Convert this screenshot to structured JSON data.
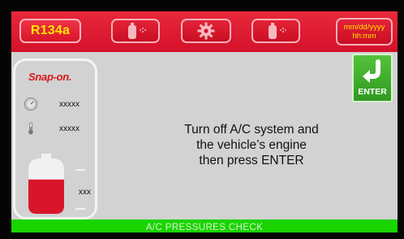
{
  "header": {
    "refrigerant": "R134a",
    "datetime_line1": "mm/dd/yyyy",
    "datetime_line2": "hh:mm",
    "icons": [
      "bottle-icon",
      "gear-icon",
      "bottle-icon"
    ]
  },
  "gauges": {
    "brand": "Snap-on.",
    "pressure_value": "xxxxx",
    "temperature_value": "xxxxx",
    "tank_value": "xxx",
    "tank_fill_fraction": 0.62
  },
  "message": {
    "lines": [
      "Turn off A/C system and",
      "the vehicle’s engine",
      "then press ENTER"
    ]
  },
  "enter_button": {
    "label": "ENTER",
    "icon": "return-arrow-icon"
  },
  "status": {
    "title": "A/C PRESSURES CHECK"
  },
  "colors": {
    "header_red": "#d4112a",
    "refrigerant_text": "#ffe500",
    "enter_green": "#3aa82a",
    "status_green": "#1ad400",
    "tank_red": "#d9152b",
    "screen_bg": "#d2d2d2"
  }
}
